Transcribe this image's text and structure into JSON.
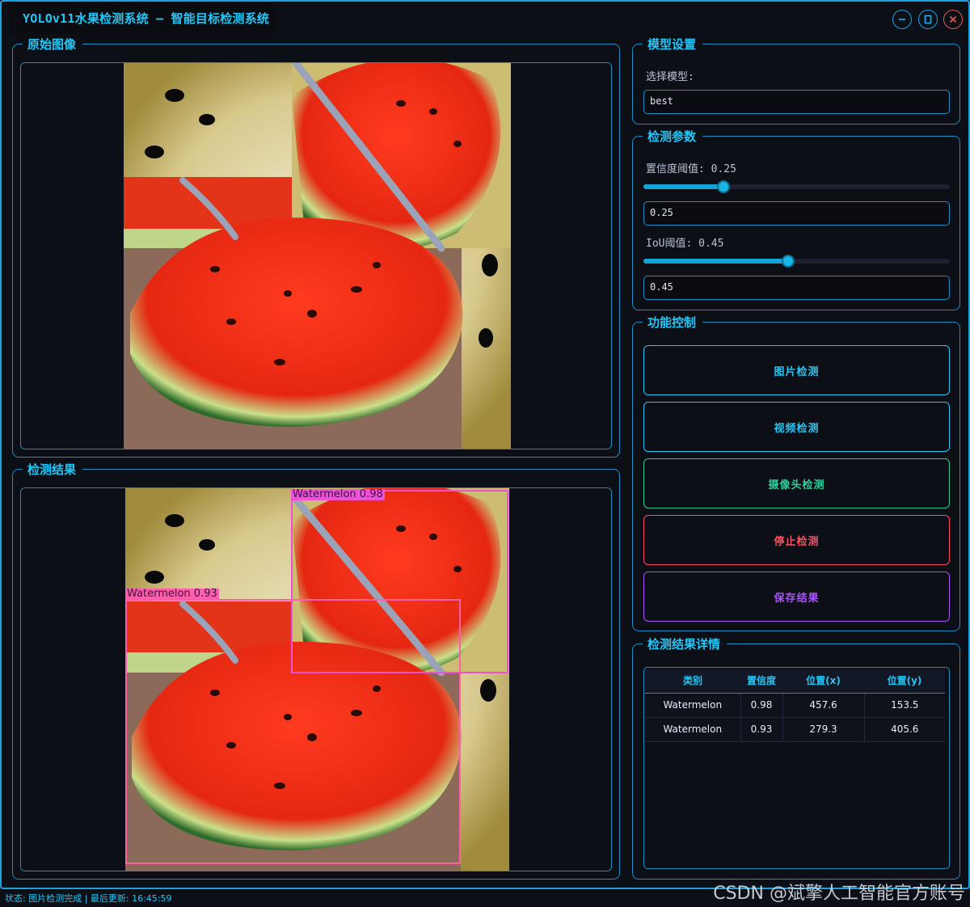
{
  "window": {
    "title": "YOLOv11水果检测系统 – 智能目标检测系统",
    "accent": "#1aa3e0",
    "controls": [
      "minimize-icon",
      "maximize-icon",
      "close-icon"
    ]
  },
  "panels": {
    "original_title": "原始图像",
    "result_title": "检测结果"
  },
  "model": {
    "group_title": "模型设置",
    "select_label": "选择模型:",
    "selected_model": "best"
  },
  "params": {
    "group_title": "检测参数",
    "confidence_label": "置信度阈值: 0.25",
    "confidence_value": "0.25",
    "confidence_level": 0.25,
    "iou_label": "IoU阈值: 0.45",
    "iou_value": "0.45",
    "iou_level": 0.45
  },
  "controls": {
    "group_title": "功能控制",
    "buttons": [
      {
        "label": "图片检测",
        "color": "#23c6f5"
      },
      {
        "label": "视频检测",
        "color": "#23c6f5"
      },
      {
        "label": "摄像头检测",
        "color": "#2ecc9a"
      },
      {
        "label": "停止检测",
        "color": "#ff4d5e"
      },
      {
        "label": "保存结果",
        "color": "#a855f7"
      }
    ]
  },
  "details": {
    "group_title": "检测结果详情",
    "columns": [
      "类别",
      "置信度",
      "位置(x)",
      "位置(y)"
    ],
    "rows": [
      [
        "Watermelon",
        "0.98",
        "457.6",
        "153.5"
      ],
      [
        "Watermelon",
        "0.93",
        "279.3",
        "405.6"
      ]
    ]
  },
  "detections": [
    {
      "label": "Watermelon  0.98",
      "color": "#f04fd6"
    },
    {
      "label": "Watermelon  0.93",
      "color": "#ff5fa8"
    }
  ],
  "statusbar": {
    "text": "状态: 图片检测完成 | 最后更新: 16:45:59"
  },
  "watermark": "CSDN @斌擎人工智能官方账号"
}
